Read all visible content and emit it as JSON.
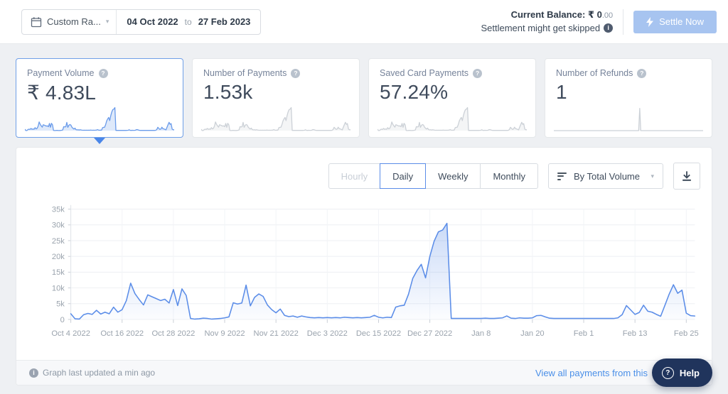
{
  "header": {
    "range_label": "Custom Ra...",
    "date_from": "04 Oct 2022",
    "to_label": "to",
    "date_to": "27 Feb 2023",
    "balance_label": "Current Balance:",
    "balance_value": "₹ 0",
    "balance_dec": ".00",
    "settlement_note": "Settlement might get skipped",
    "settle_button": "Settle Now"
  },
  "cards": [
    {
      "label": "Payment Volume",
      "value": "₹ 4.83L",
      "selected": true,
      "spark": "volume",
      "color": "#6a9bea"
    },
    {
      "label": "Number of Payments",
      "value": "1.53k",
      "selected": false,
      "spark": "volume",
      "color": "#ccd1d7"
    },
    {
      "label": "Saved Card Payments",
      "value": "57.24%",
      "selected": false,
      "spark": "volume",
      "color": "#ccd1d7"
    },
    {
      "label": "Number of Refunds",
      "value": "1",
      "selected": false,
      "spark": "refunds",
      "color": "#ccd1d7"
    }
  ],
  "controls": {
    "tabs": [
      {
        "label": "Hourly",
        "state": "disabled"
      },
      {
        "label": "Daily",
        "state": "selected"
      },
      {
        "label": "Weekly",
        "state": "normal"
      },
      {
        "label": "Monthly",
        "state": "normal"
      }
    ],
    "sort_dropdown": "By Total Volume"
  },
  "chart_data": {
    "type": "area",
    "title": "Daily payment volume, 04 Oct 2022 to 27 Feb 2023",
    "granularity": "Daily",
    "ylim": [
      0,
      35000
    ],
    "y_tick_labels": [
      "0",
      "5k",
      "10k",
      "15k",
      "20k",
      "25k",
      "30k",
      "35k"
    ],
    "x_tick_labels": [
      "Oct 4 2022",
      "Oct 16 2022",
      "Oct 28 2022",
      "Nov 9 2022",
      "Nov 21 2022",
      "Dec 3 2022",
      "Dec 15 2022",
      "Dec 27 2022",
      "Jan 8",
      "Jan 20",
      "Feb 1",
      "Feb 13",
      "Feb 25"
    ],
    "x_tick_day_indexes": [
      0,
      12,
      24,
      36,
      48,
      60,
      72,
      84,
      96,
      108,
      120,
      132,
      144
    ],
    "grid": true,
    "legend": false,
    "line_color": "#5b8de8",
    "values_unit": "thousands",
    "values_k": [
      1.8,
      0.2,
      0.1,
      1.5,
      1.9,
      1.6,
      2.9,
      1.7,
      2.3,
      1.8,
      3.9,
      2.3,
      3.1,
      6.0,
      11.5,
      8.2,
      6.3,
      4.6,
      7.8,
      7.2,
      6.6,
      6.0,
      6.4,
      5.2,
      9.5,
      4.4,
      9.7,
      7.6,
      0.3,
      0.1,
      0.2,
      0.4,
      0.3,
      0.1,
      0.2,
      0.3,
      0.5,
      0.8,
      5.3,
      4.9,
      5.2,
      10.9,
      4.3,
      7.0,
      8.1,
      7.3,
      4.6,
      3.1,
      2.1,
      3.3,
      1.3,
      0.9,
      1.1,
      0.7,
      1.1,
      0.8,
      0.6,
      0.5,
      0.6,
      0.5,
      0.6,
      0.5,
      0.6,
      0.5,
      0.7,
      0.6,
      0.5,
      0.6,
      0.5,
      0.6,
      0.7,
      1.3,
      0.7,
      0.5,
      0.7,
      0.6,
      3.9,
      4.3,
      4.5,
      8.0,
      13.0,
      15.5,
      17.5,
      13.2,
      20.0,
      24.8,
      27.8,
      28.4,
      30.5,
      0.3,
      0.3,
      0.3,
      0.3,
      0.3,
      0.3,
      0.3,
      0.3,
      0.4,
      0.3,
      0.3,
      0.4,
      0.5,
      1.1,
      0.4,
      0.3,
      0.5,
      0.4,
      0.4,
      0.5,
      1.2,
      1.3,
      0.8,
      0.4,
      0.3,
      0.3,
      0.3,
      0.3,
      0.3,
      0.3,
      0.3,
      0.3,
      0.3,
      0.3,
      0.3,
      0.3,
      0.3,
      0.3,
      0.3,
      0.5,
      1.5,
      4.4,
      3.0,
      1.6,
      2.2,
      4.5,
      2.6,
      2.3,
      1.6,
      1.0,
      4.5,
      8.0,
      11.0,
      8.3,
      9.3,
      2.0,
      1.2,
      1.1
    ],
    "refunds_spark": {
      "total_points": 147,
      "spike_index": 84,
      "spike_value": 1,
      "baseline": 0
    }
  },
  "footer": {
    "updated": "Graph last updated a min ago",
    "link": "View all payments from this",
    "help": "Help"
  }
}
